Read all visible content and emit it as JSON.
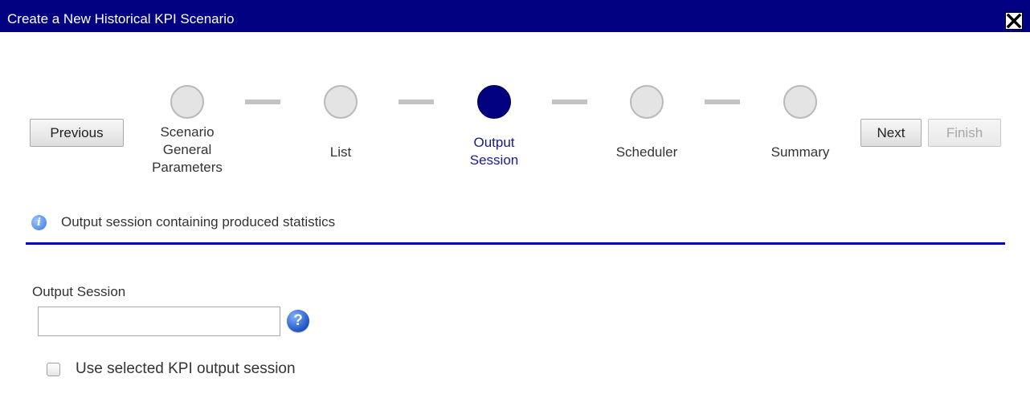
{
  "dialog": {
    "title": "Create a New Historical KPI Scenario",
    "close_icon": "close-icon"
  },
  "nav": {
    "previous_label": "Previous",
    "next_label": "Next",
    "finish_label": "Finish",
    "finish_disabled": true
  },
  "wizard": {
    "active_step": 2,
    "steps": [
      {
        "label": "Scenario General Parameters",
        "lines": [
          "Scenario",
          "General",
          "Parameters"
        ],
        "state": "inactive"
      },
      {
        "label": "List",
        "lines": [
          "List"
        ],
        "state": "inactive"
      },
      {
        "label": "Output Session",
        "lines": [
          "Output",
          "Session"
        ],
        "state": "active"
      },
      {
        "label": "Scheduler",
        "lines": [
          "Scheduler"
        ],
        "state": "inactive"
      },
      {
        "label": "Summary",
        "lines": [
          "Summary"
        ],
        "state": "inactive"
      }
    ]
  },
  "info": {
    "icon": "info-icon",
    "text": "Output session containing produced statistics"
  },
  "form": {
    "output_session_label": "Output Session",
    "output_session_value": "",
    "output_session_placeholder": "",
    "help_icon": "help-icon",
    "use_selected_label": "Use selected KPI output session",
    "use_selected_checked": false
  },
  "colors": {
    "titlebar": "#000080",
    "active_step": "#000080",
    "divider": "#0000cc",
    "inactive_step": "#e4e4e4"
  }
}
